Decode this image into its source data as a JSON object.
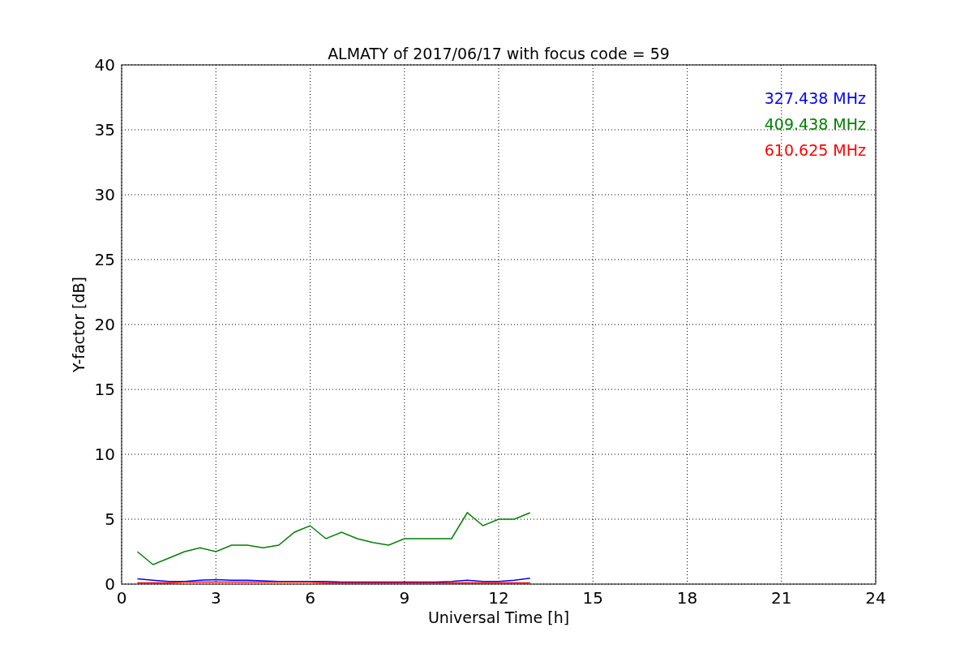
{
  "figure": {
    "chart_data": {
      "type": "line",
      "title": "ALMATY of 2017/06/17 with focus code = 59",
      "xlabel": "Universal Time [h]",
      "ylabel": "Y-factor [dB]",
      "x": [
        0.5,
        1,
        1.5,
        2,
        2.5,
        3,
        3.5,
        4,
        4.5,
        5,
        5.5,
        6,
        6.5,
        7,
        7.5,
        8,
        8.5,
        9,
        9.5,
        10,
        10.5,
        11,
        11.5,
        12,
        12.5,
        13
      ],
      "series": [
        {
          "name": "327.438 MHz",
          "color": "#0000ff",
          "values": [
            0.4,
            0.3,
            0.2,
            0.2,
            0.3,
            0.35,
            0.3,
            0.3,
            0.25,
            0.2,
            0.2,
            0.2,
            0.2,
            0.15,
            0.15,
            0.15,
            0.15,
            0.15,
            0.15,
            0.15,
            0.2,
            0.3,
            0.2,
            0.2,
            0.3,
            0.45
          ]
        },
        {
          "name": "409.438 MHz",
          "color": "#008000",
          "values": [
            2.5,
            1.5,
            2,
            2.5,
            2.8,
            2.5,
            3,
            3,
            2.8,
            3,
            4,
            4.5,
            3.5,
            4,
            3.5,
            3.2,
            3,
            3.5,
            3.5,
            3.5,
            3.5,
            5.5,
            4.5,
            5,
            5,
            5.5
          ]
        },
        {
          "name": "610.625 MHz",
          "color": "#ff0000",
          "values": [
            0.1,
            0.1,
            0.1,
            0.15,
            0.15,
            0.15,
            0.15,
            0.15,
            0.15,
            0.15,
            0.15,
            0.15,
            0.1,
            0.1,
            0.1,
            0.1,
            0.1,
            0.1,
            0.1,
            0.1,
            0.1,
            0.1,
            0.1,
            0.1,
            0.1,
            0.1
          ]
        }
      ],
      "xlim": [
        0,
        24
      ],
      "ylim": [
        0,
        40
      ],
      "xticks": [
        0,
        3,
        6,
        9,
        12,
        15,
        18,
        21,
        24
      ],
      "yticks": [
        0,
        5,
        10,
        15,
        20,
        25,
        30,
        35,
        40
      ],
      "grid": true
    }
  }
}
